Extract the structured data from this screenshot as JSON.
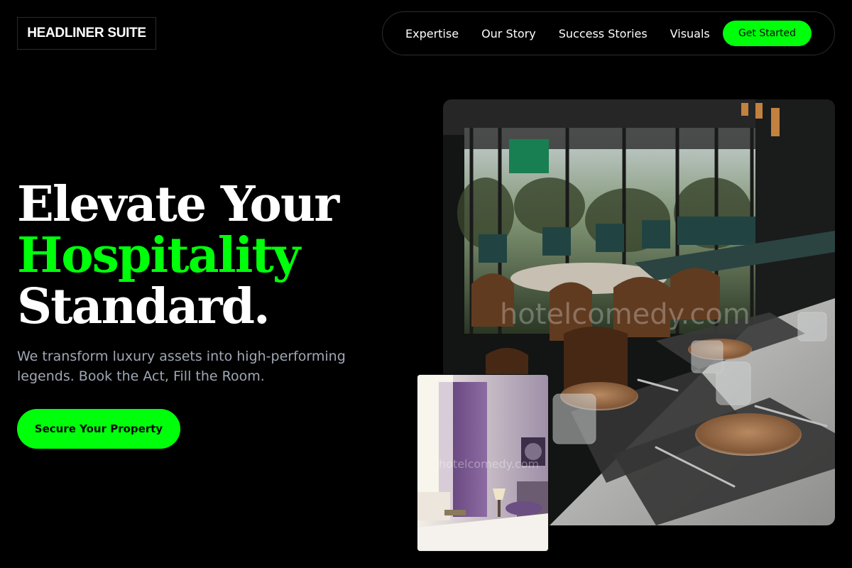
{
  "brand": {
    "logo_text": "HEADLINER SUITE"
  },
  "nav": {
    "links": [
      "Expertise",
      "Our Story",
      "Success Stories",
      "Visuals"
    ],
    "cta_label": "Get Started"
  },
  "hero": {
    "headline_line1": "Elevate Your",
    "headline_line2": "Hospitality",
    "headline_line3": "Standard.",
    "subtext": "We transform luxury assets into high-performing legends. Book the Act, Fill the Room.",
    "cta_label": "Secure Your Property"
  },
  "images": {
    "main_watermark": "hotelcomedy.com",
    "inset_watermark": "hotelcomedy.com"
  },
  "colors": {
    "accent": "#00ff0a",
    "background": "#000000",
    "subtext": "#a0a7b4"
  }
}
